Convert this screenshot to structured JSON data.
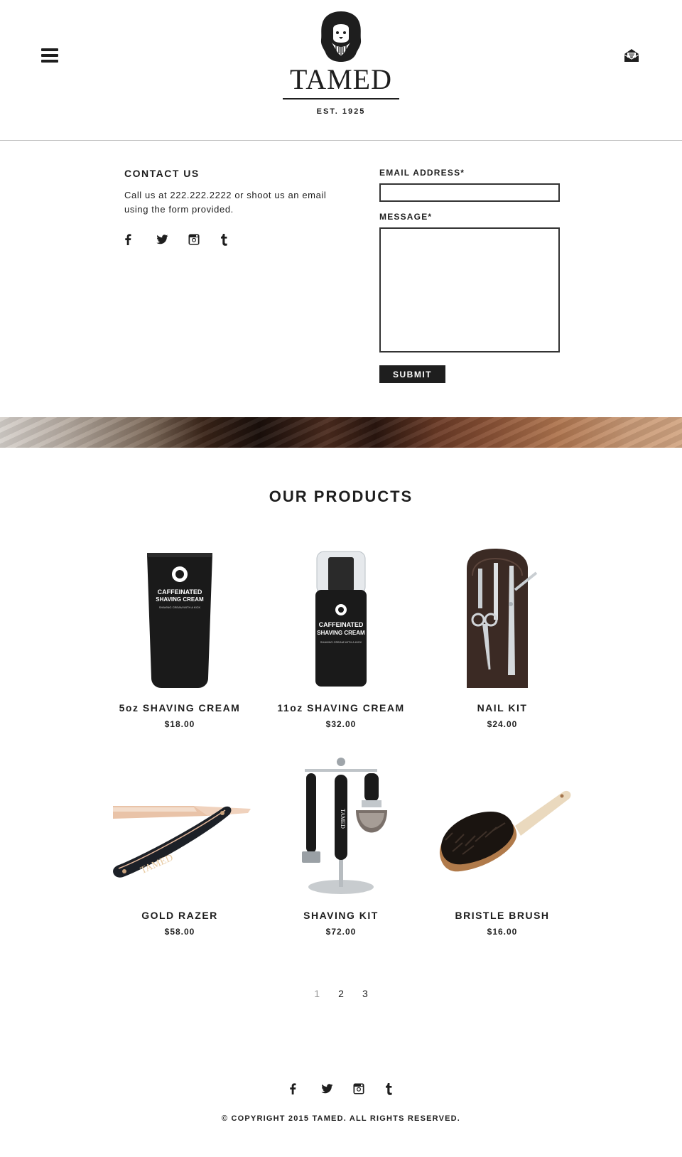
{
  "header": {
    "brand": "TAMED",
    "tagline": "EST. 1925",
    "menu_icon": "hamburger-menu-icon",
    "mail_icon": "envelope-open-icon"
  },
  "contact": {
    "title": "CONTACT US",
    "text": "Call us at 222.222.2222 or shoot us an email using the form provided.",
    "social_icons": [
      "facebook-icon",
      "twitter-icon",
      "instagram-icon",
      "tumblr-icon"
    ]
  },
  "form": {
    "email_label": "EMAIL ADDRESS*",
    "email_value": "",
    "message_label": "MESSAGE*",
    "message_value": "",
    "submit_label": "SUBMIT"
  },
  "products": {
    "title": "OUR PRODUCTS",
    "items": [
      {
        "name": "5oz SHAVING CREAM",
        "price": "$18.00",
        "label_line1": "CAFFEINATED",
        "label_line2": "SHAVING CREAM",
        "label_line3": "SHAVING CREAM WITH A KICK"
      },
      {
        "name": "11oz SHAVING CREAM",
        "price": "$32.00",
        "label_line1": "CAFFEINATED",
        "label_line2": "SHAVING CREAM",
        "label_line3": "SHAVING CREAM WITH A KICK"
      },
      {
        "name": "NAIL KIT",
        "price": "$24.00"
      },
      {
        "name": "GOLD RAZER",
        "price": "$58.00",
        "engraving": "TAMED"
      },
      {
        "name": "SHAVING KIT",
        "price": "$72.00",
        "engraving": "TAMED"
      },
      {
        "name": "BRISTLE BRUSH",
        "price": "$16.00"
      }
    ]
  },
  "pagination": {
    "pages": [
      "1",
      "2",
      "3"
    ],
    "current": "1"
  },
  "footer": {
    "social_icons": [
      "facebook-icon",
      "twitter-icon",
      "instagram-icon",
      "tumblr-icon"
    ],
    "copyright": "© COPYRIGHT 2015 TAMED. ALL RIGHTS RESERVED."
  },
  "colors": {
    "text": "#1e1e1e",
    "rule": "#bdbdbd",
    "button": "#1e1e1e",
    "pager_current": "#999999"
  }
}
